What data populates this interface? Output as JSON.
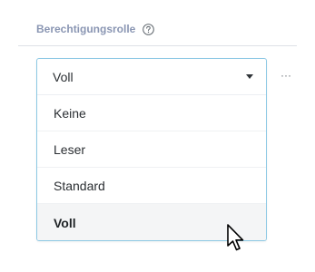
{
  "field": {
    "label": "Berechtigungsrolle",
    "help_icon": "question-circle-icon"
  },
  "select": {
    "current_value": "Voll",
    "options": [
      {
        "label": "Keine",
        "selected": false
      },
      {
        "label": "Leser",
        "selected": false
      },
      {
        "label": "Standard",
        "selected": false
      },
      {
        "label": "Voll",
        "selected": true
      }
    ]
  },
  "more_button": {
    "label": "···",
    "icon": "more-horizontal-icon"
  },
  "colors": {
    "label": "#8a96b3",
    "select_border": "#8cc8e4",
    "selected_option_bg": "#f4f5f6",
    "text": "#2b2f33"
  }
}
